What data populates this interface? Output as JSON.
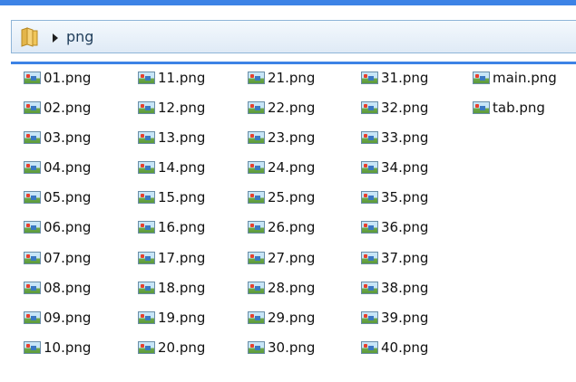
{
  "address_bar": {
    "crumb": "png"
  },
  "files": [
    "01.png",
    "02.png",
    "03.png",
    "04.png",
    "05.png",
    "06.png",
    "07.png",
    "08.png",
    "09.png",
    "10.png",
    "11.png",
    "12.png",
    "13.png",
    "14.png",
    "15.png",
    "16.png",
    "17.png",
    "18.png",
    "19.png",
    "20.png",
    "21.png",
    "22.png",
    "23.png",
    "24.png",
    "25.png",
    "26.png",
    "27.png",
    "28.png",
    "29.png",
    "30.png",
    "31.png",
    "32.png",
    "33.png",
    "34.png",
    "35.png",
    "36.png",
    "37.png",
    "38.png",
    "39.png",
    "40.png",
    "main.png",
    "tab.png"
  ]
}
